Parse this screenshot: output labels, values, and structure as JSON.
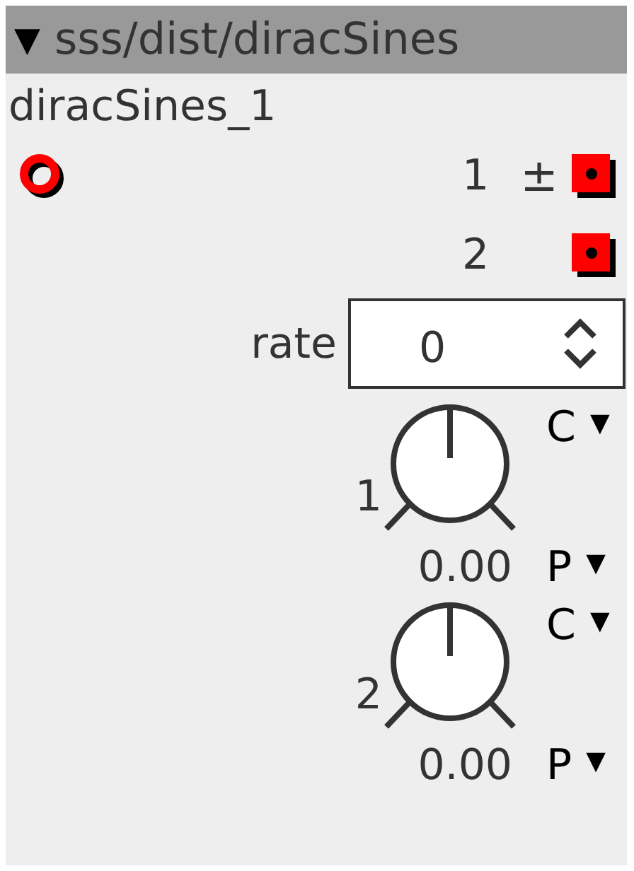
{
  "header": {
    "toggle": "▼",
    "title": "sss/dist/diracSines"
  },
  "instance_name": "diracSines_1",
  "outlets": [
    {
      "label": "1",
      "symbol": "±"
    },
    {
      "label": "2"
    }
  ],
  "attribute": {
    "label": "rate",
    "value": "0"
  },
  "knobs": [
    {
      "label": "1",
      "value": "0.00",
      "top_menu": {
        "label": "C",
        "caret": "▼"
      },
      "bottom_menu": {
        "label": "P",
        "caret": "▼"
      }
    },
    {
      "label": "2",
      "value": "0.00",
      "top_menu": {
        "label": "C",
        "caret": "▼"
      },
      "bottom_menu": {
        "label": "P",
        "caret": "▼"
      }
    }
  ]
}
